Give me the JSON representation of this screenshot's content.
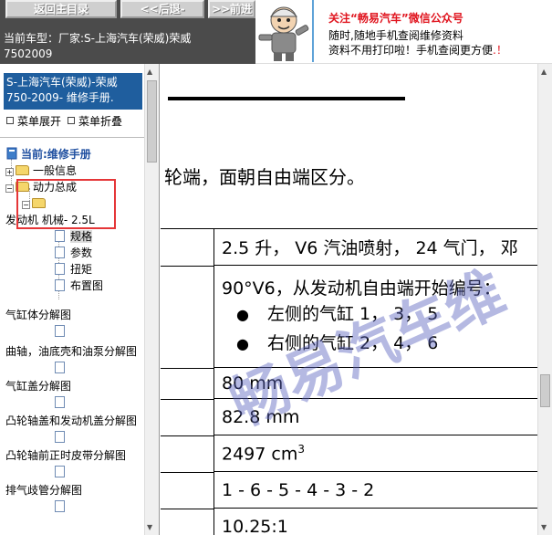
{
  "toolbar": {
    "home_label": "返回主目录",
    "back_label": "<<后退-",
    "forward_label": ">>前进"
  },
  "model_bar": {
    "line1": "当前车型：厂家:S-上海汽车(荣威)荣威",
    "line2": "7502009"
  },
  "ad": {
    "title": "关注“畅易汽车”微信公众号",
    "line2": "随时,随地手机查阅维修资料",
    "line3_main": "资料不用打印啦！手机查阅更方便",
    "line3_accent": ".！",
    "icons": {
      "mascot": "mechanic-mascot-icon"
    },
    "colors": {
      "title": "#e0141e",
      "divider": "#5fa3d8"
    }
  },
  "left_pane": {
    "manual_title_line1": "S-上海汽车(荣威)-荣威",
    "manual_title_line2": "750-2009- 维修手册.",
    "expand_label": "菜单展开",
    "collapse_label": "菜单折叠",
    "tree": {
      "current": "当前:维修手册",
      "general_info": "一般信息",
      "powertrain": "动力总成",
      "engine_mech": "发动机 机械- 2.5L",
      "spec": "规格",
      "params": "参数",
      "torque": "扭矩",
      "layout_diagram": "布置图",
      "cylinder_block": "气缸体分解图",
      "crankshaft": "曲轴，油底壳和油泵分解图",
      "cylinder_head_cover": "气缸盖分解图",
      "camshaft_cover": "凸轮轴盖和发动机盖分解图",
      "timing_belt": "凸轮轴前正时皮带分解图",
      "exhaust_manifold": "排气歧管分解图"
    },
    "highlight_color": "#e53638"
  },
  "content": {
    "intro": "轮端，面朝自由端区分。",
    "rows": {
      "r1": "2.5 升， V6 汽油喷射， 24 气门， 邓",
      "r2_head": "90°V6，从发动机自由端开始编号：",
      "r2_left": "左侧的气缸 1， 3， 5",
      "r2_right": "右侧的气缸 2， 4， 6",
      "r3": "80 mm",
      "r4": "82.8 mm",
      "r5": "2497 cm",
      "r5_sup": "3",
      "r6": "1 - 6 - 5 - 4 - 3 - 2",
      "r7": "10.25:1"
    },
    "watermark": "畅易汽车维"
  }
}
